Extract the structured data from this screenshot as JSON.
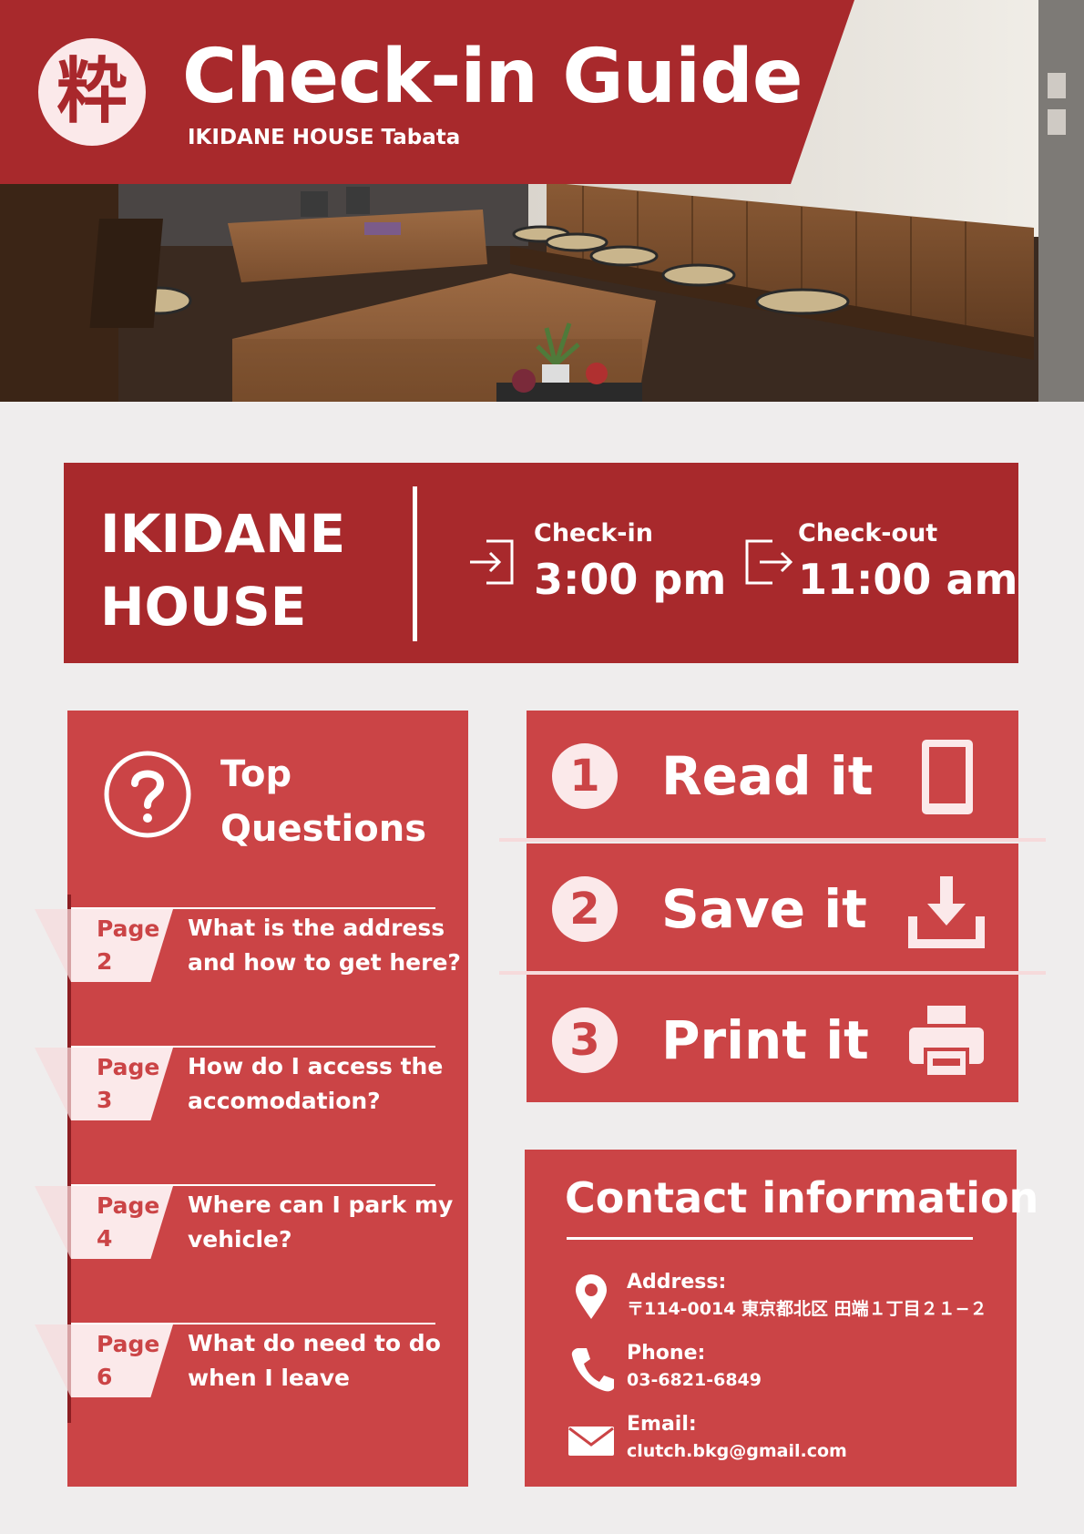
{
  "header": {
    "logo_char": "粋",
    "title": "Check-in Guide",
    "subtitle": "IKIDANE HOUSE Tabata"
  },
  "info": {
    "house_name_line1": "IKIDANE",
    "house_name_line2": "HOUSE",
    "checkin_label": "Check-in",
    "checkin_time": "3:00 pm",
    "checkout_label": "Check-out",
    "checkout_time": "11:00 am"
  },
  "questions": {
    "title_line1": "Top",
    "title_line2": "Questions",
    "items": [
      {
        "page_word": "Page",
        "page_num": "2",
        "line1": "What is the address",
        "line2": "and how to get here?"
      },
      {
        "page_word": "Page",
        "page_num": "3",
        "line1": "How do I access the",
        "line2": "accomodation?"
      },
      {
        "page_word": "Page",
        "page_num": "4",
        "line1": "Where can I park my",
        "line2": "vehicle?"
      },
      {
        "page_word": "Page",
        "page_num": "6",
        "line1": "What do need to do",
        "line2": "when I leave"
      }
    ]
  },
  "steps": [
    {
      "num": "1",
      "label": "Read it",
      "icon": "tablet-icon"
    },
    {
      "num": "2",
      "label": "Save it",
      "icon": "download-icon"
    },
    {
      "num": "3",
      "label": "Print it",
      "icon": "printer-icon"
    }
  ],
  "contact": {
    "title": "Contact information",
    "address_label": "Address:",
    "address_value": "〒114-0014 東京都北区 田端１丁目２１−２",
    "phone_label": "Phone:",
    "phone_value": "03-6821-6849",
    "email_label": "Email:",
    "email_value": "clutch.bkg@gmail.com"
  },
  "colors": {
    "brand_dark": "#a8292c",
    "brand": "#cb4446",
    "pale": "#fbe9ea",
    "background": "#efeded"
  }
}
